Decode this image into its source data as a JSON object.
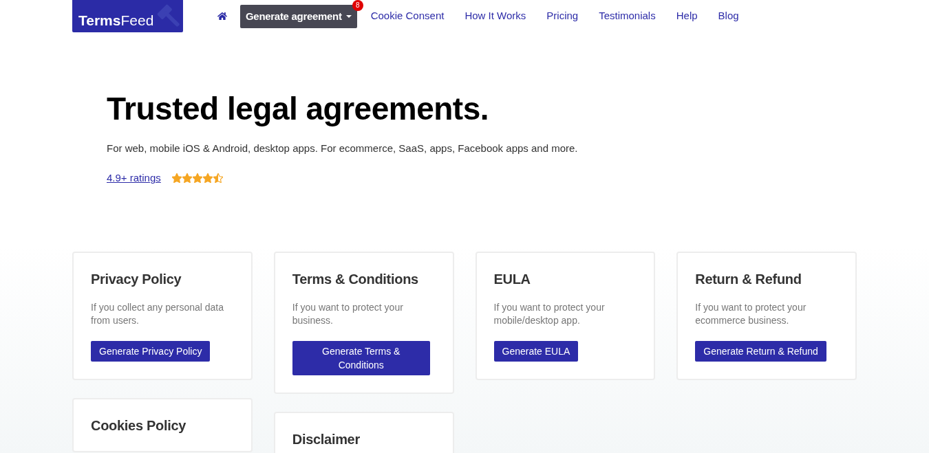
{
  "header": {
    "logo": "**Terms**Feed",
    "menu_button": {
      "label": "Generate agreement",
      "badge": "8"
    },
    "nav_links": [
      "Cookie Consent",
      "How It Works",
      "Pricing",
      "Testimonials",
      "Help",
      "Blog"
    ]
  },
  "hero": {
    "title": "Trusted legal agreements.",
    "subtitle": "For web, mobile iOS & Android, desktop apps. For ecommerce, SaaS, apps, Facebook apps and more.",
    "rating_link": "4.9+ ratings",
    "stars": 4.5
  },
  "cards": [
    {
      "title": "Privacy Policy",
      "description": "If you collect any personal data from users.",
      "button": "Generate Privacy Policy"
    },
    {
      "title": "Terms & Conditions",
      "description": "If you want to protect your business.",
      "button": "Generate Terms & Conditions"
    },
    {
      "title": "EULA",
      "description": "If you want to protect your mobile/desktop app.",
      "button": "Generate EULA"
    },
    {
      "title": "Return & Refund",
      "description": "If you want to protect your ecommerce business.",
      "button": "Generate Return & Refund"
    },
    {
      "title": "Cookies Policy"
    },
    {
      "title": "Disclaimer"
    }
  ]
}
